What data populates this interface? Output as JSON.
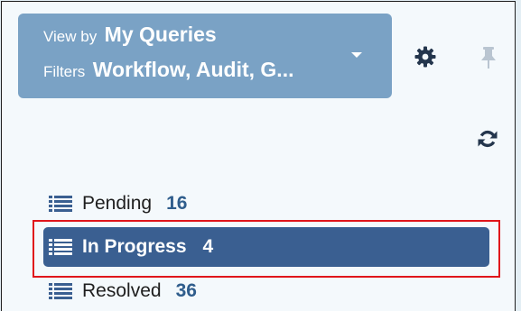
{
  "view_selector": {
    "view_caption": "View by",
    "view_value": "My Queries",
    "filters_caption": "Filters",
    "filters_value": "Workflow, Audit, G..."
  },
  "icons": {
    "settings": "gear-icon",
    "pin": "pin-icon",
    "refresh": "refresh-icon",
    "list": "list-icon",
    "dropdown": "caret-down-icon"
  },
  "queues": [
    {
      "label": "Pending",
      "count": "16"
    },
    {
      "label": "In Progress",
      "count": "4",
      "selected": true
    },
    {
      "label": "Resolved",
      "count": "36"
    }
  ],
  "colors": {
    "header_bg": "#7aa2c5",
    "selected_bg": "#3a5f91",
    "count_text": "#2f5d8c",
    "highlight_border": "#e0161b",
    "panel_bg": "#f4f9fc",
    "page_bg": "#e3eef4"
  }
}
